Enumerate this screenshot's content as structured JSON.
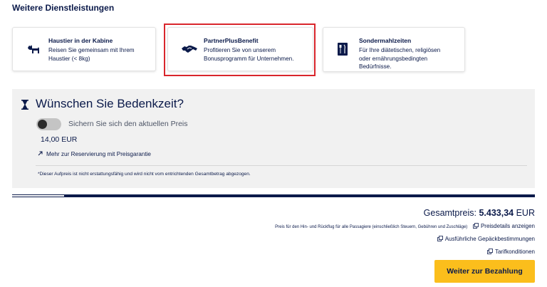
{
  "section": {
    "title": "Weitere Dienstleistungen"
  },
  "cards": [
    {
      "icon": "dog-icon",
      "title": "Haustier in der Kabine",
      "lines": [
        "Reisen Sie gemeinsam mit Ihrem",
        "Haustier (< 8kg)"
      ]
    },
    {
      "icon": "handshake-icon",
      "title": "PartnerPlusBenefit",
      "lines": [
        "Profitieren Sie von unserem",
        "Bonusprogramm für Unternehmen."
      ]
    },
    {
      "icon": "meal-icon",
      "title": "Sondermahlzeiten",
      "lines": [
        "Für Ihre diätetischen, religiösen",
        "oder ernährungsbedingten",
        "Bedürfnisse."
      ]
    }
  ],
  "bedenkzeit": {
    "icon": "hourglass-icon",
    "title": "Wünschen Sie Bedenkzeit?",
    "toggle_label": "Sichern Sie sich den aktuellen Preis",
    "toggle_on": false,
    "price": "14,00 EUR",
    "more_link": "Mehr zur Reservierung mit Preisgarantie",
    "disclaimer": "*Dieser Aufpreis ist nicht erstattungsfähig und wird nicht vom entrichtenden Gesamtbetrag abgezogen."
  },
  "progress": {
    "fraction": 0.1
  },
  "summary": {
    "total_label": "Gesamtpreis: ",
    "total_value": "5.433,34",
    "currency": " EUR",
    "price_note": "Preis für den Hin- und Rückflug für alle Passagiere (einschließlich Steuern, Gebühren und Zuschläge)",
    "price_details_link": "Preisdetails anzeigen",
    "baggage_link": "Ausführliche Gepäckbestimmungen",
    "tariff_link": "Tarifkonditionen",
    "pay_button": "Weiter zur Bezahlung"
  },
  "colors": {
    "navy": "#0b1a4a",
    "accent_yellow": "#fbbe1c",
    "highlight_red": "#d9262c",
    "panel_gray": "#f1f1f1"
  }
}
